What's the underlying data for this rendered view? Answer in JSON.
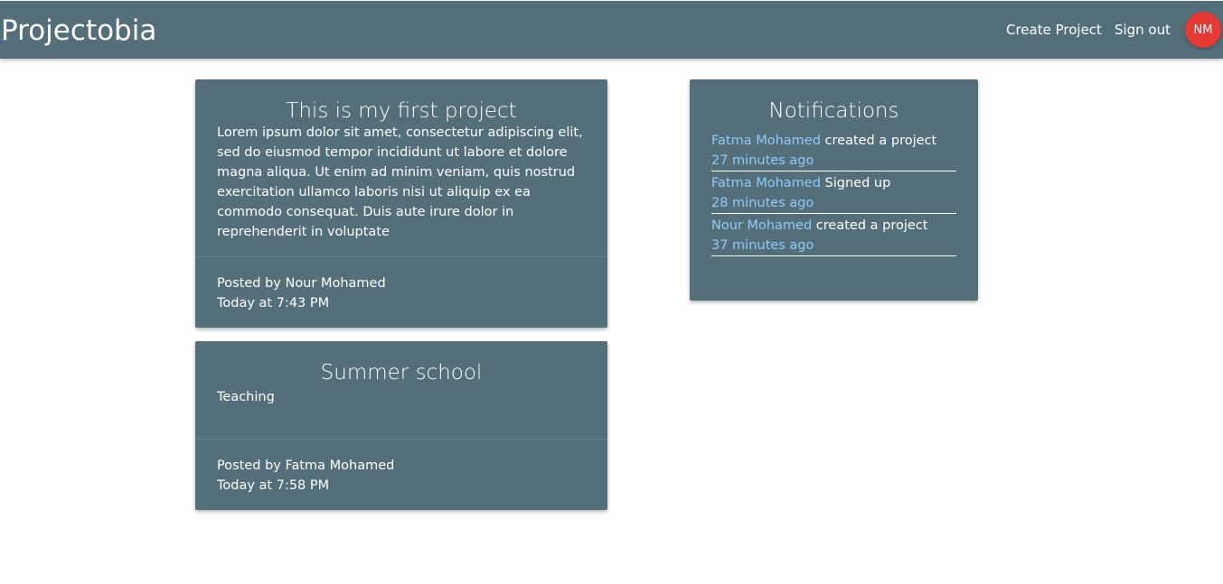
{
  "navbar": {
    "brand": "Projectobia",
    "create_project": "Create Project",
    "sign_out": "Sign out",
    "avatar_initials": "NM"
  },
  "projects": [
    {
      "title": "This is my first project",
      "content": "Lorem ipsum dolor sit amet, consectetur adipiscing elit, sed do eiusmod tempor incididunt ut labore et dolore magna aliqua. Ut enim ad minim veniam, quis nostrud exercitation ullamco laboris nisi ut aliquip ex ea commodo consequat. Duis aute irure dolor in reprehenderit in voluptate",
      "posted_by": "Posted by Nour Mohamed",
      "time": "Today at 7:43 PM"
    },
    {
      "title": "Summer school",
      "content": "Teaching",
      "posted_by": "Posted by Fatma Mohamed",
      "time": "Today at 7:58 PM"
    }
  ],
  "notifications": {
    "title": "Notifications",
    "items": [
      {
        "user": "Fatma Mohamed",
        "action": " created a project",
        "time": "27 minutes ago"
      },
      {
        "user": "Fatma Mohamed",
        "action": " Signed up",
        "time": "28 minutes ago"
      },
      {
        "user": "Nour Mohamed",
        "action": " created a project",
        "time": "37 minutes ago"
      }
    ]
  },
  "colors": {
    "navbar": "#546e7a",
    "card": "#546e7a",
    "avatar": "#e53935",
    "link_accent": "#90caf9"
  }
}
